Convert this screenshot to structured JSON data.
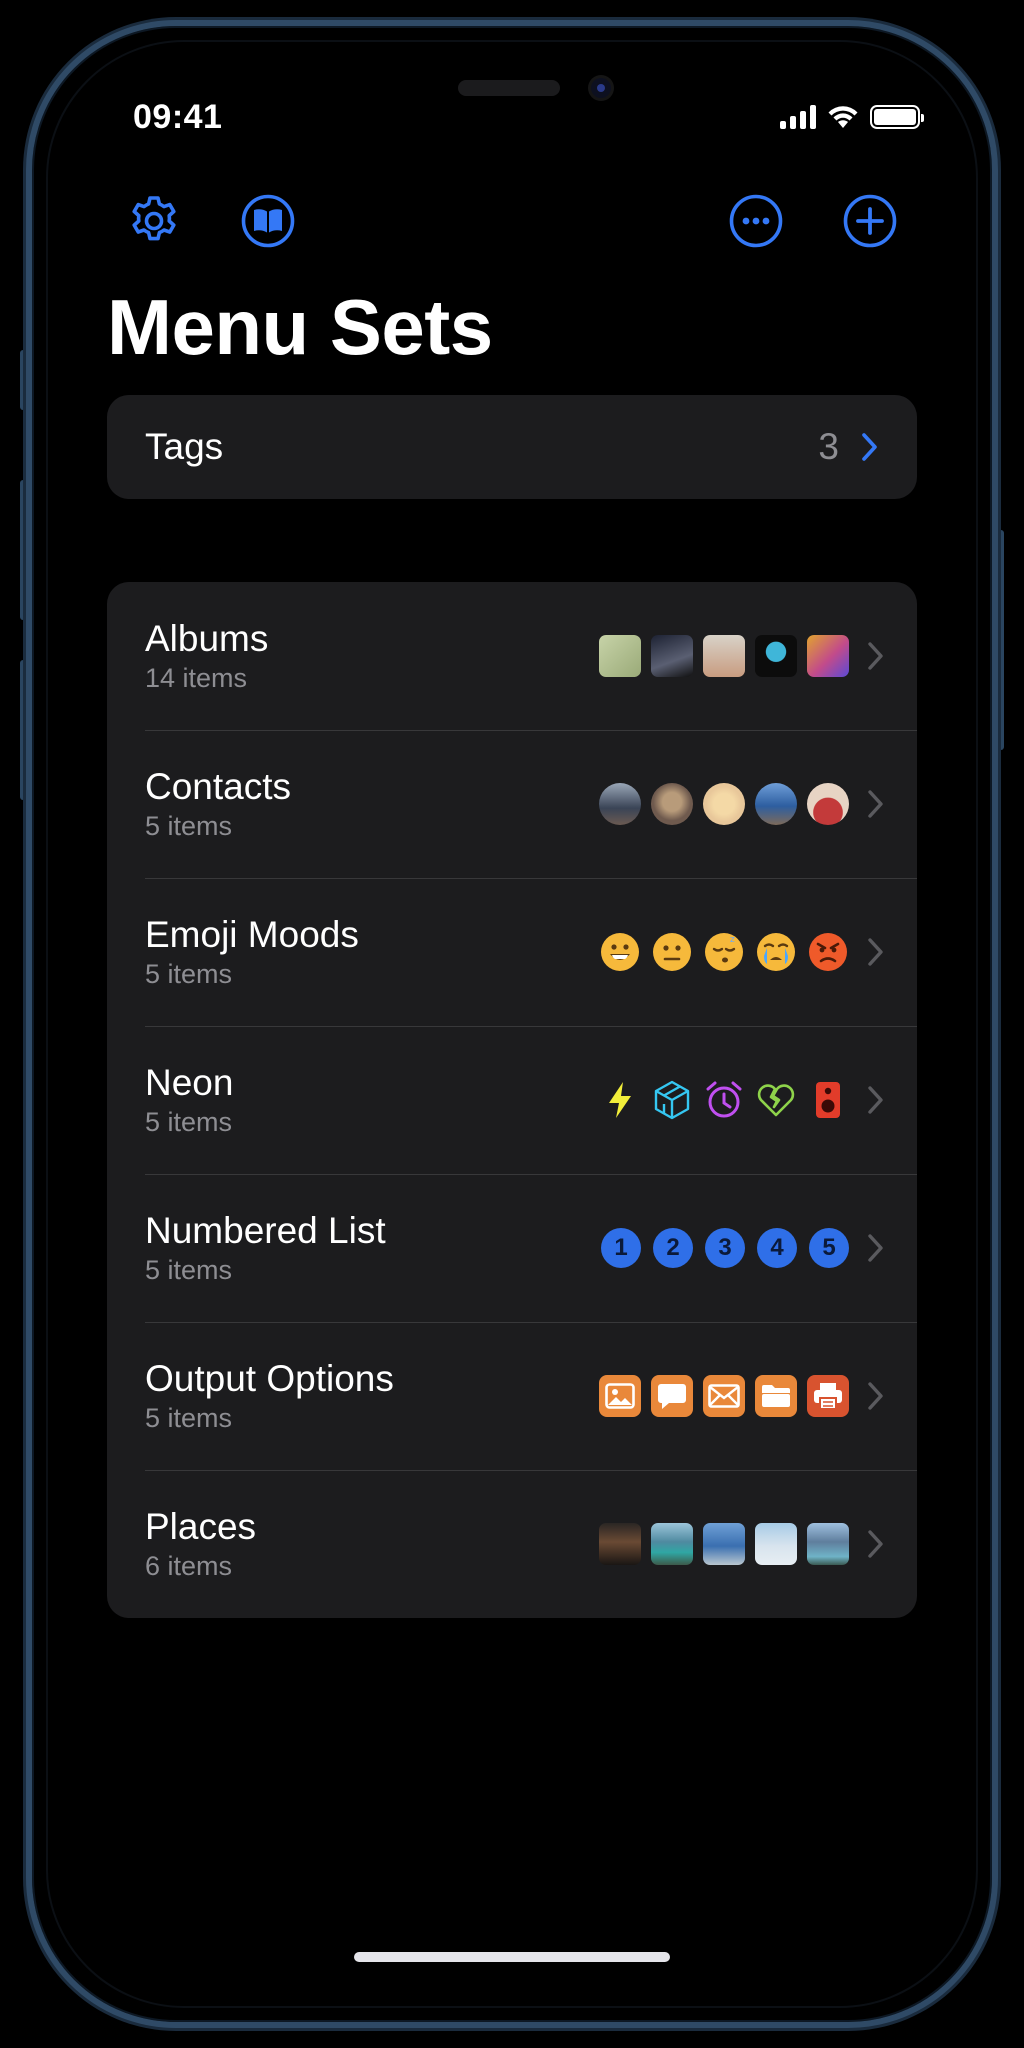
{
  "status_bar": {
    "time": "09:41"
  },
  "toolbar": {
    "settings_icon": "gear-icon",
    "library_icon": "book-icon",
    "more_icon": "ellipsis-circle-icon",
    "add_icon": "plus-circle-icon"
  },
  "page": {
    "title": "Menu Sets"
  },
  "tags": {
    "label": "Tags",
    "count": "3"
  },
  "menu_sets": [
    {
      "title": "Albums",
      "subtitle": "14 items",
      "thumbs": "photo-thumbnails"
    },
    {
      "title": "Contacts",
      "subtitle": "5 items",
      "thumbs": "avatar-thumbnails"
    },
    {
      "title": "Emoji Moods",
      "subtitle": "5 items",
      "thumbs": "emoji-faces"
    },
    {
      "title": "Neon",
      "subtitle": "5 items",
      "thumbs": "neon-symbols"
    },
    {
      "title": "Numbered List",
      "subtitle": "5 items",
      "numbers": [
        "1",
        "2",
        "3",
        "4",
        "5"
      ]
    },
    {
      "title": "Output Options",
      "subtitle": "5 items",
      "thumbs": "output-icons"
    },
    {
      "title": "Places",
      "subtitle": "6 items",
      "thumbs": "landscape-thumbnails"
    }
  ],
  "colors": {
    "accent": "#3478f6",
    "background": "#000000",
    "cell": "#1c1c1e",
    "secondary_text": "#8e8e93",
    "separator": "#38383a"
  }
}
